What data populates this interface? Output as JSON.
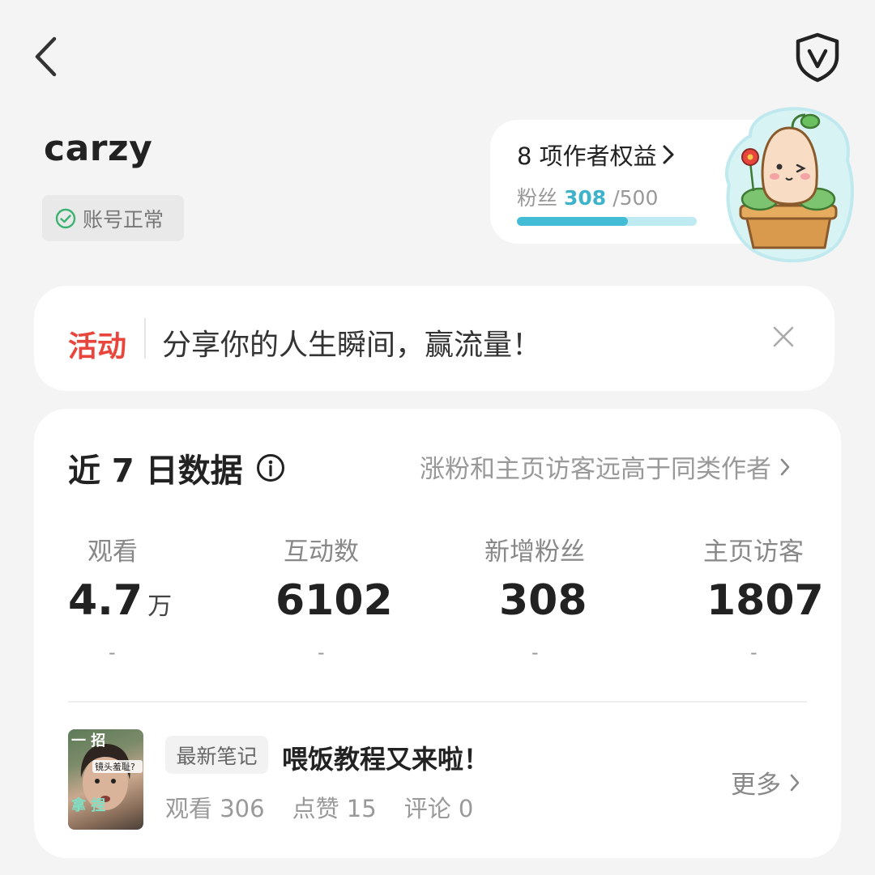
{
  "header": {
    "back_icon": "chevron-left-icon",
    "shield_icon": "verified-shield-icon",
    "shield_letter": "V"
  },
  "profile": {
    "username": "carzy",
    "status_label": "账号正常"
  },
  "rights": {
    "title": "8 项作者权益",
    "fans_label": "粉丝",
    "fans_current": "308",
    "fans_target": "/500",
    "progress_fraction": 0.616,
    "accent_color": "#43bcd6"
  },
  "activity": {
    "tag": "活动",
    "text": "分享你的人生瞬间，赢流量！",
    "tag_color": "#e8453c"
  },
  "stats": {
    "title": "近 7 日数据",
    "hint": "涨粉和主页访客远高于同类作者",
    "metrics": [
      {
        "label": "观看",
        "value": "4.7",
        "unit": "万",
        "change": "-"
      },
      {
        "label": "互动数",
        "value": "6102",
        "unit": "",
        "change": "-"
      },
      {
        "label": "新增粉丝",
        "value": "308",
        "unit": "",
        "change": "-"
      },
      {
        "label": "主页访客",
        "value": "1807",
        "unit": "",
        "change": "-"
      }
    ]
  },
  "latest_note": {
    "tag": "最新笔记",
    "title": "喂饭教程又来啦！",
    "views": "观看 306",
    "likes": "点赞 15",
    "comments": "评论 0",
    "more_label": "更多",
    "thumb_text_top": "一 招",
    "thumb_caption": "镜头羞耻?",
    "thumb_text_bottom": "拿 捏"
  }
}
